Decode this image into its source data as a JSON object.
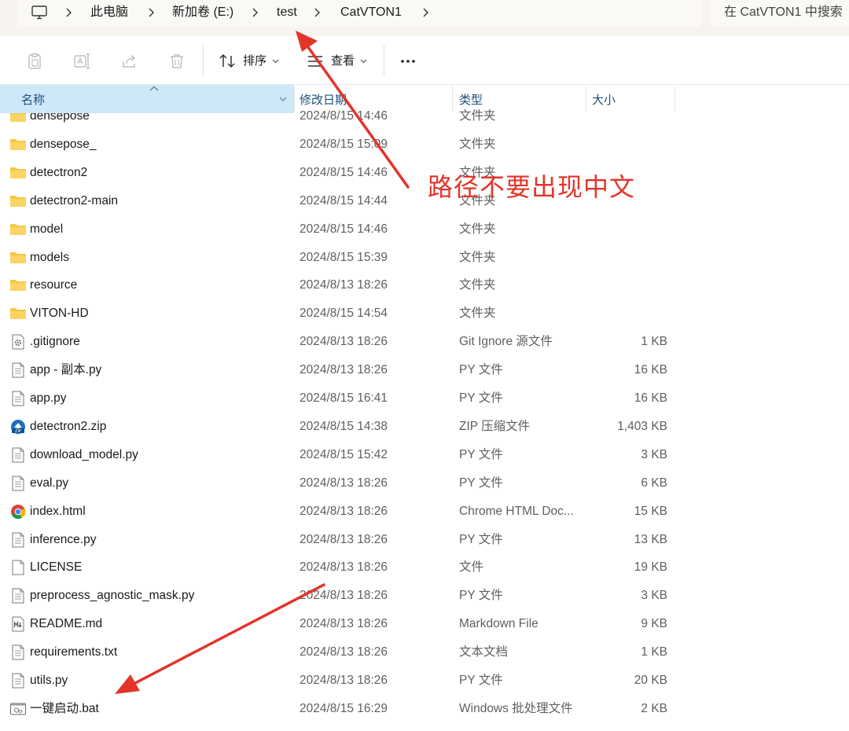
{
  "address": {
    "crumbs": [
      "此电脑",
      "新加卷 (E:)",
      "test",
      "CatVTON1"
    ],
    "search_placeholder": "在 CatVTON1 中搜索"
  },
  "toolbar": {
    "sort_label": "排序",
    "view_label": "查看"
  },
  "columns": {
    "name": "名称",
    "modified": "修改日期",
    "type": "类型",
    "size": "大小"
  },
  "files": [
    {
      "name": "densepose",
      "modified": "2024/8/15 14:46",
      "type": "文件夹",
      "size": "",
      "icon": "folder-icon"
    },
    {
      "name": "densepose_",
      "modified": "2024/8/15 15:09",
      "type": "文件夹",
      "size": "",
      "icon": "folder-icon"
    },
    {
      "name": "detectron2",
      "modified": "2024/8/15 14:46",
      "type": "文件夹",
      "size": "",
      "icon": "folder-icon"
    },
    {
      "name": "detectron2-main",
      "modified": "2024/8/15 14:44",
      "type": "文件夹",
      "size": "",
      "icon": "folder-icon"
    },
    {
      "name": "model",
      "modified": "2024/8/15 14:46",
      "type": "文件夹",
      "size": "",
      "icon": "folder-icon"
    },
    {
      "name": "models",
      "modified": "2024/8/15 15:39",
      "type": "文件夹",
      "size": "",
      "icon": "folder-icon"
    },
    {
      "name": "resource",
      "modified": "2024/8/13 18:26",
      "type": "文件夹",
      "size": "",
      "icon": "folder-icon"
    },
    {
      "name": "VITON-HD",
      "modified": "2024/8/15 14:54",
      "type": "文件夹",
      "size": "",
      "icon": "folder-icon"
    },
    {
      "name": ".gitignore",
      "modified": "2024/8/13 18:26",
      "type": "Git Ignore 源文件",
      "size": "1 KB",
      "icon": "config-file-icon"
    },
    {
      "name": "app - 副本.py",
      "modified": "2024/8/13 18:26",
      "type": "PY 文件",
      "size": "16 KB",
      "icon": "text-file-icon"
    },
    {
      "name": "app.py",
      "modified": "2024/8/15 16:41",
      "type": "PY 文件",
      "size": "16 KB",
      "icon": "text-file-icon"
    },
    {
      "name": "detectron2.zip",
      "modified": "2024/8/15 14:38",
      "type": "ZIP 压缩文件",
      "size": "1,403 KB",
      "icon": "zip-file-icon"
    },
    {
      "name": "download_model.py",
      "modified": "2024/8/15 15:42",
      "type": "PY 文件",
      "size": "3 KB",
      "icon": "text-file-icon"
    },
    {
      "name": "eval.py",
      "modified": "2024/8/13 18:26",
      "type": "PY 文件",
      "size": "6 KB",
      "icon": "text-file-icon"
    },
    {
      "name": "index.html",
      "modified": "2024/8/13 18:26",
      "type": "Chrome HTML Doc...",
      "size": "15 KB",
      "icon": "chrome-icon"
    },
    {
      "name": "inference.py",
      "modified": "2024/8/13 18:26",
      "type": "PY 文件",
      "size": "13 KB",
      "icon": "text-file-icon"
    },
    {
      "name": "LICENSE",
      "modified": "2024/8/13 18:26",
      "type": "文件",
      "size": "19 KB",
      "icon": "blank-file-icon"
    },
    {
      "name": "preprocess_agnostic_mask.py",
      "modified": "2024/8/13 18:26",
      "type": "PY 文件",
      "size": "3 KB",
      "icon": "text-file-icon"
    },
    {
      "name": "README.md",
      "modified": "2024/8/13 18:26",
      "type": "Markdown File",
      "size": "9 KB",
      "icon": "markdown-file-icon"
    },
    {
      "name": "requirements.txt",
      "modified": "2024/8/13 18:26",
      "type": "文本文档",
      "size": "1 KB",
      "icon": "text-file-icon"
    },
    {
      "name": "utils.py",
      "modified": "2024/8/13 18:26",
      "type": "PY 文件",
      "size": "20 KB",
      "icon": "text-file-icon"
    },
    {
      "name": "一键启动.bat",
      "modified": "2024/8/15 16:29",
      "type": "Windows 批处理文件",
      "size": "2 KB",
      "icon": "batch-file-icon"
    }
  ],
  "annotation": {
    "text": "路径不要出现中文",
    "color": "#e3342a"
  },
  "colors": {
    "folder": "#f6c744",
    "header_selected": "#cde8f9",
    "header_text": "#1e4f7a"
  }
}
